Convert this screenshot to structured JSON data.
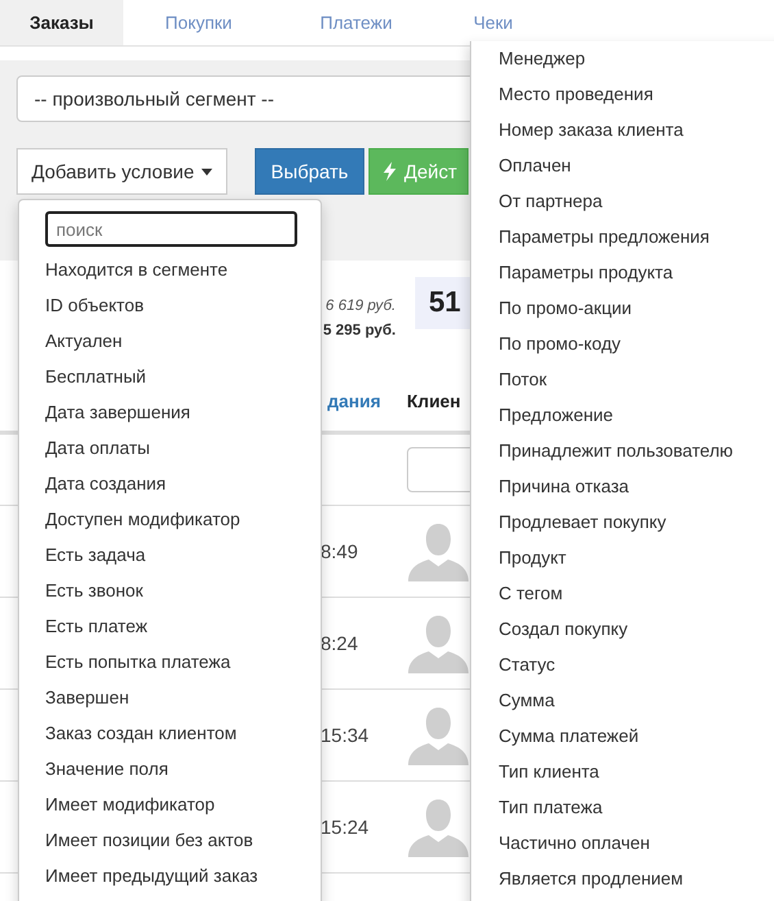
{
  "tabs": [
    {
      "label": "Заказы",
      "selected": true
    },
    {
      "label": "Покупки",
      "selected": false
    },
    {
      "label": "Платежи",
      "selected": false
    },
    {
      "label": "Чеки",
      "selected": false
    }
  ],
  "segment_select": {
    "value": "-- произвольный сегмент --"
  },
  "buttons": [
    {
      "label": "Добавить условие",
      "kind": "dropdown"
    },
    {
      "label": "Выбрать",
      "kind": "primary"
    },
    {
      "label": "Дейст",
      "kind": "action"
    }
  ],
  "stats": {
    "sum_1": "6 619 руб.",
    "sum_2": "5 295 руб.",
    "count": "51"
  },
  "table": {
    "columns": [
      "дания",
      "Клиен"
    ],
    "rows": [
      {
        "time": "8:49"
      },
      {
        "time": "8:24"
      },
      {
        "time": "15:34"
      },
      {
        "time": "15:24"
      }
    ]
  },
  "condition_menu": {
    "search": {
      "placeholder": "поиск"
    },
    "items": [
      "Находится в сегменте",
      "ID объектов",
      "Актуален",
      "Бесплатный",
      "Дата завершения",
      "Дата оплаты",
      "Дата создания",
      "Доступен модификатор",
      "Есть задача",
      "Есть звонок",
      "Есть платеж",
      "Есть попытка платежа",
      "Завершен",
      "Заказ создан клиентом",
      "Значение поля",
      "Имеет модификатор",
      "Имеет позиции без актов",
      "Имеет предыдущий заказ"
    ]
  },
  "condition_menu_column_2": {
    "items": [
      "Менеджер",
      "Место проведения",
      "Номер заказа клиента",
      "Оплачен",
      "От партнера",
      "Параметры предложения",
      "Параметры продукта",
      "По промо-акции",
      "По промо-коду",
      "Поток",
      "Предложение",
      "Принадлежит пользователю",
      "Причина отказа",
      "Продлевает покупку",
      "Продукт",
      "С тегом",
      "Создал покупку",
      "Статус",
      "Сумма",
      "Сумма платежей",
      "Тип клиента",
      "Тип платежа",
      "Частично оплачен",
      "Является продлением"
    ]
  }
}
